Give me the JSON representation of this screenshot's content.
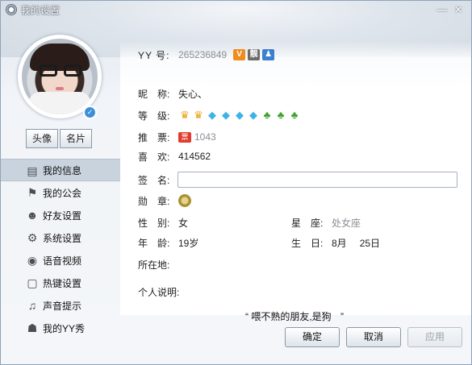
{
  "window": {
    "title": "我的设置",
    "min_glyph": "—",
    "close_glyph": "✕"
  },
  "sidebar": {
    "buttons": [
      {
        "label": "头像"
      },
      {
        "label": "名片"
      }
    ],
    "items": [
      {
        "label": "我的信息",
        "icon": "id-card-icon",
        "glyph": "▤",
        "active": true
      },
      {
        "label": "我的公会",
        "icon": "flag-icon",
        "glyph": "⚑",
        "active": false
      },
      {
        "label": "好友设置",
        "icon": "friend-settings-icon",
        "glyph": "☻",
        "active": false
      },
      {
        "label": "系统设置",
        "icon": "gear-icon",
        "glyph": "⚙",
        "active": false
      },
      {
        "label": "语音视频",
        "icon": "webcam-icon",
        "glyph": "◉",
        "active": false
      },
      {
        "label": "热键设置",
        "icon": "hotkey-icon",
        "glyph": "▢",
        "active": false
      },
      {
        "label": "声音提示",
        "icon": "music-note-icon",
        "glyph": "♫",
        "active": false
      },
      {
        "label": "我的YY秀",
        "icon": "wardrobe-icon",
        "glyph": "☗",
        "active": false
      }
    ]
  },
  "profile": {
    "yy_label": "YY 号:",
    "yy_value": "265236849",
    "nickname_label": "昵　称:",
    "nickname_value": "失心、",
    "level_label": "等　级:",
    "level_icons": [
      "crown",
      "crown",
      "diamond",
      "diamond",
      "diamond",
      "diamond",
      "leaf",
      "leaf",
      "leaf"
    ],
    "votes_label": "推　票:",
    "votes_value": "1043",
    "likes_label": "喜　欢:",
    "likes_value": "414562",
    "sign_label": "签　名:",
    "sign_value": "",
    "medal_label": "勋　章:",
    "gender_label": "性　别:",
    "gender_value": "女",
    "zodiac_label": "星　座:",
    "zodiac_value": "处女座",
    "age_label": "年　龄:",
    "age_value": "19岁",
    "birthday_label": "生　日:",
    "birthday_month": "8月",
    "birthday_day": "25日",
    "location_label": "所在地:",
    "location_value": "",
    "bio_label": "个人说明:",
    "bio_value": "喂不熟的朋友,是狗",
    "bio_quote_open": "“",
    "bio_quote_close": "”"
  },
  "footer": {
    "ok": "确定",
    "cancel": "取消",
    "apply": "应用"
  },
  "colors": {
    "accent": "#3a7fd0",
    "active_nav_bg": "#c9d3de",
    "disabled_text": "#9aa1a8"
  }
}
